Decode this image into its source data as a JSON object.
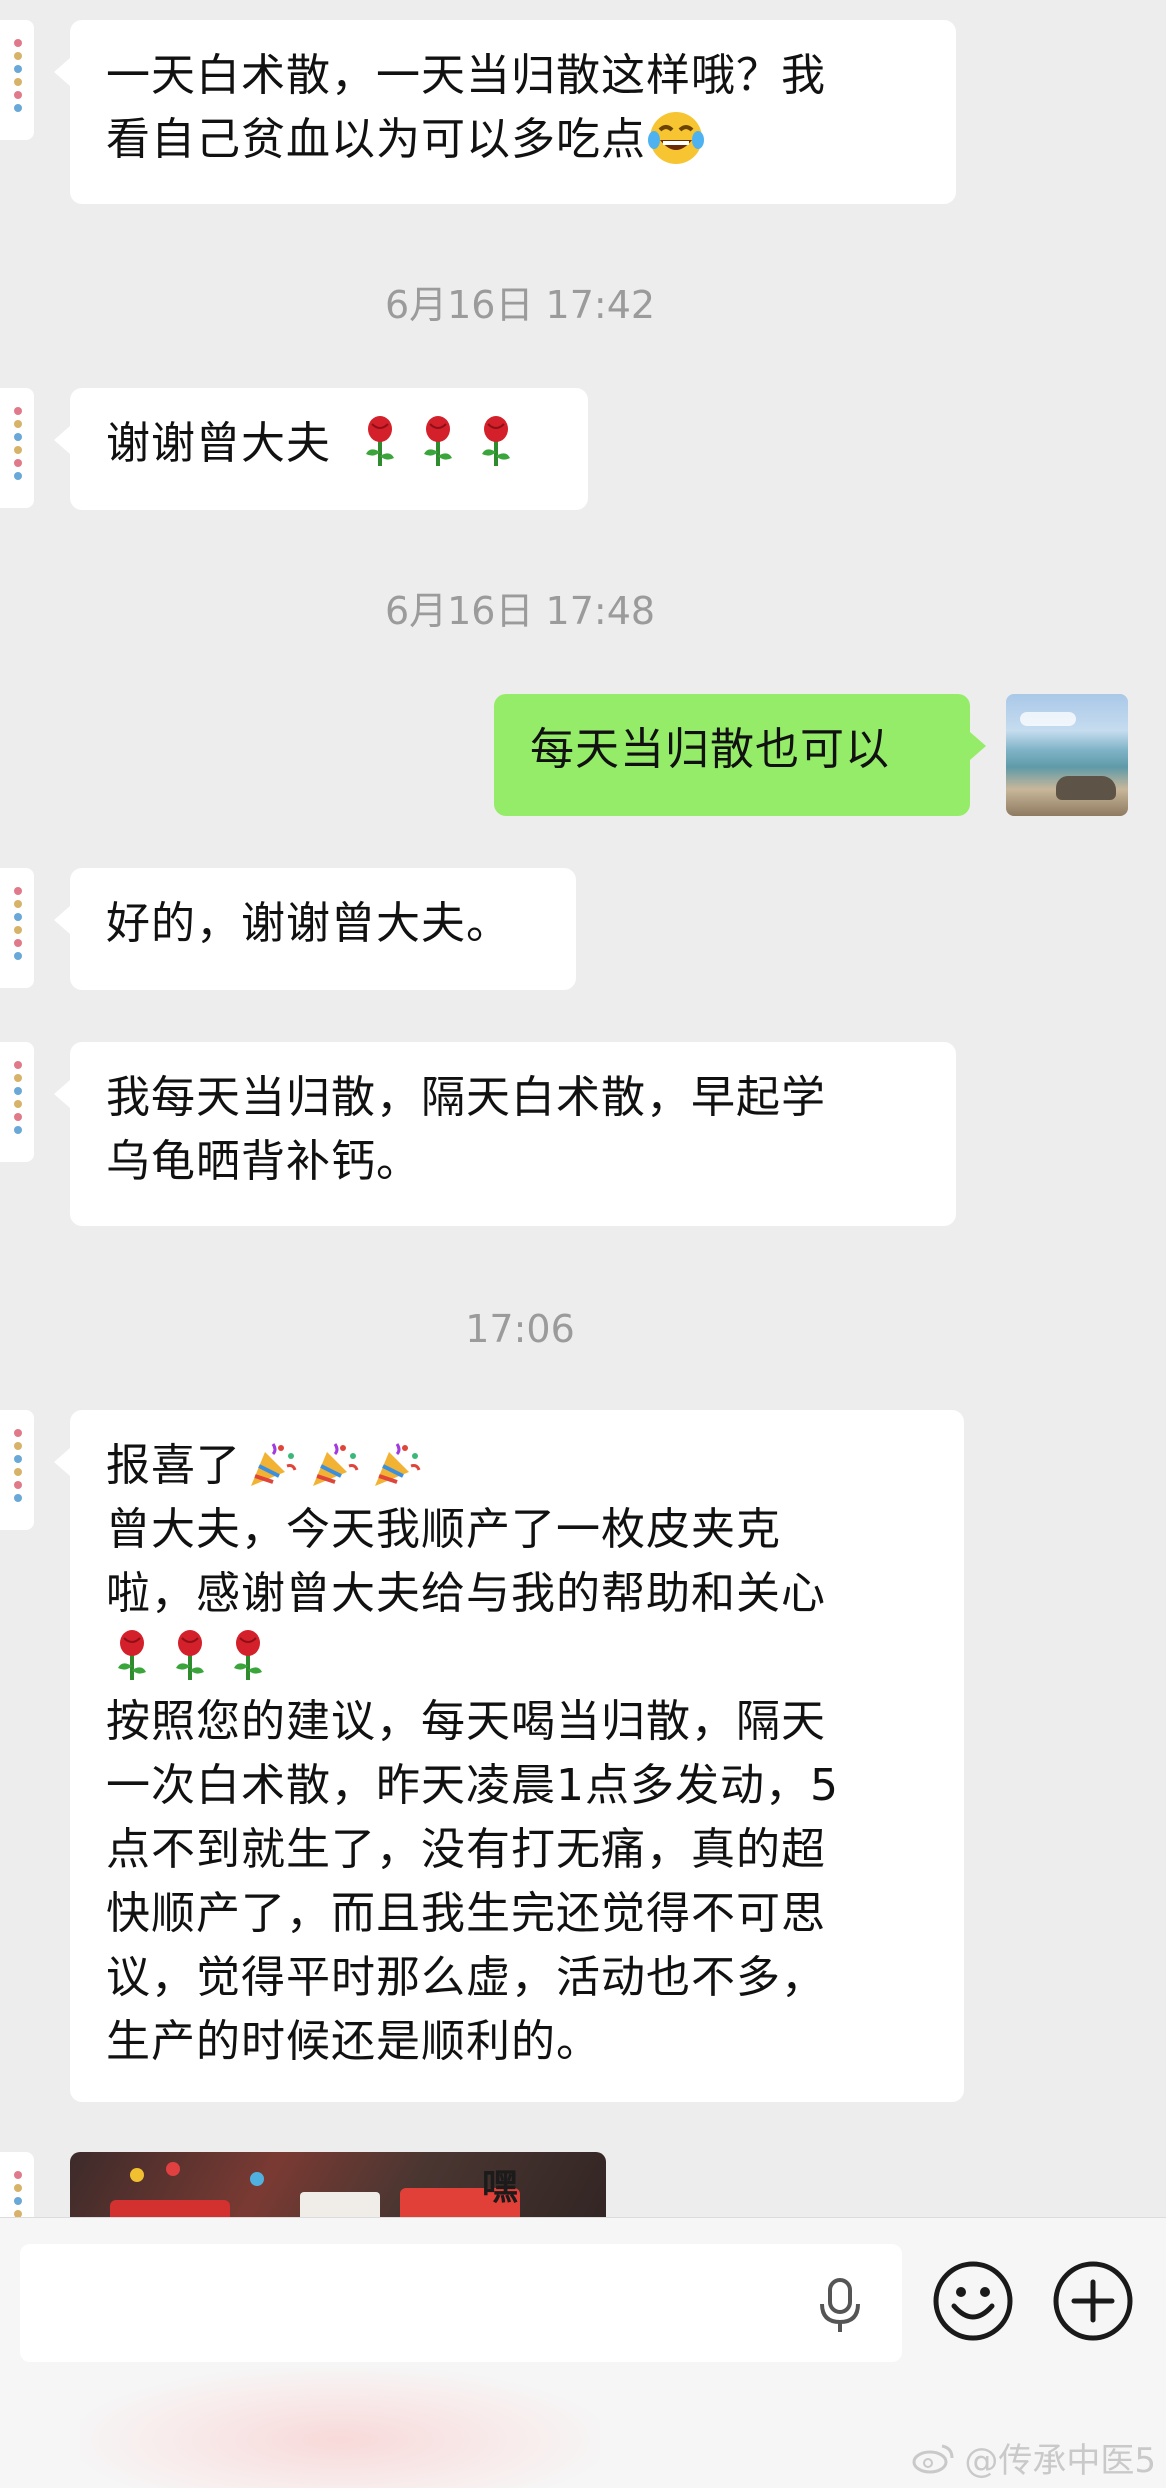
{
  "messages": [
    {
      "lines": [
        "一天白术散，一天当归散这样哦？我",
        "看自己贫血以为可以多吃点"
      ],
      "trailing_emoji": "laugh-cry-emoji"
    },
    {
      "time": "6月16日 17:42"
    },
    {
      "text": "谢谢曾大夫",
      "emoji": "rose-emoji x3"
    },
    {
      "time": "6月16日 17:48"
    },
    {
      "text": "每天当归散也可以"
    },
    {
      "text": "好的，谢谢曾大夫。"
    },
    {
      "lines": [
        "我每天当归散，隔天白术散，早起学",
        "乌龟晒背补钙。"
      ]
    },
    {
      "time": "17:06"
    },
    {
      "lines": [
        "报喜了",
        "曾大夫，今天我顺产了一枚皮夹克",
        "啦，感谢曾大夫给与我的帮助和关心",
        "",
        "按照您的建议，每天喝当归散，隔天",
        "一次白术散，昨天凌晨1点多发动，5",
        "点不到就生了，没有打无痛，真的超",
        "快顺产了，而且我生完还觉得不可思",
        "议，觉得平时那么虚，活动也不多，",
        "生产的时候还是顺利的。"
      ],
      "emojis": [
        "party-popper-emoji x3",
        "rose-emoji x3"
      ]
    }
  ],
  "photo_text": "嘿",
  "watermark": "@传承中医5",
  "colors": {
    "chat_bg": "#ededed",
    "incoming_bubble": "#ffffff",
    "outgoing_bubble": "#95ec69",
    "timestamp": "#9b9b9b"
  }
}
